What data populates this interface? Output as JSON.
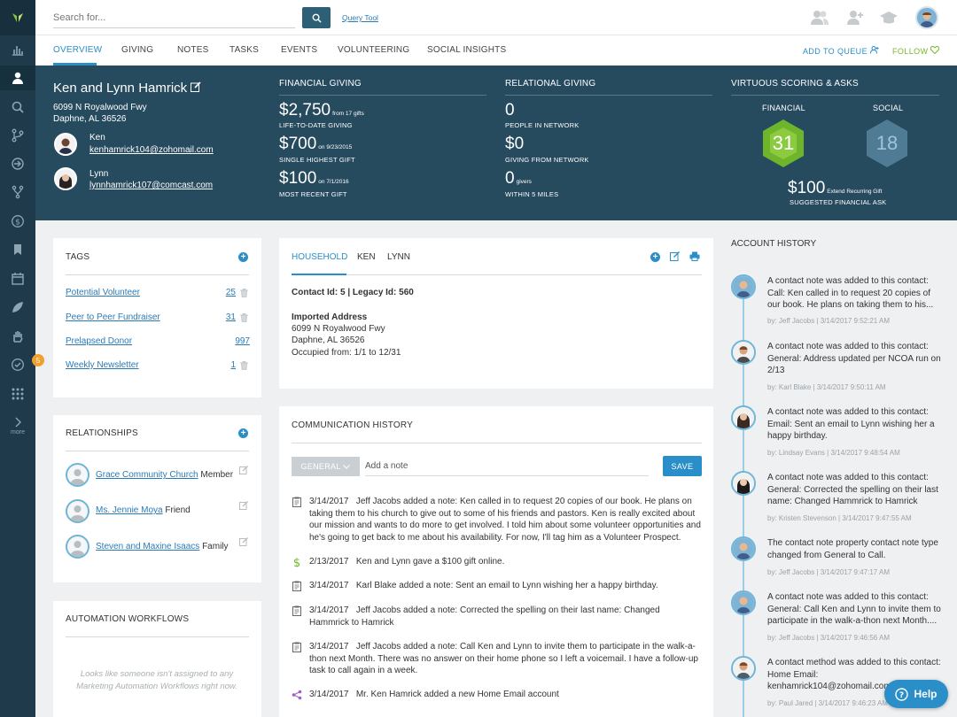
{
  "colors": {
    "rail": "#1f3a4b",
    "band": "#264a5e",
    "accent": "#2a8fc8",
    "follow": "#7ab72f",
    "financial_score": "#6fb52c",
    "social_score": "#4f7b95"
  },
  "rail": {
    "icons": [
      "logo-icon",
      "chart-icon",
      "person-icon",
      "search-icon",
      "branch-icon",
      "signin-icon",
      "fork-icon",
      "dollar-icon",
      "bookmark-icon",
      "calendar-icon",
      "leaf-icon",
      "hand-icon",
      "check-icon",
      "grid-icon",
      "chevron-right-icon"
    ],
    "badge": "5",
    "more": "more"
  },
  "topbar": {
    "search_placeholder": "Search for...",
    "query_tool": "Query Tool"
  },
  "nav": {
    "tabs": [
      "OVERVIEW",
      "GIVING",
      "NOTES",
      "TASKS",
      "EVENTS",
      "VOLUNTEERING",
      "SOCIAL INSIGHTS"
    ],
    "add_to_queue": "ADD TO QUEUE",
    "follow": "FOLLOW"
  },
  "profile": {
    "name": "Ken and Lynn Hamrick",
    "address1": "6099 N Royalwood Fwy",
    "address2": "Daphne, AL 36526",
    "people": [
      {
        "name": "Ken",
        "email": "kenhamrick104@zohomail.com"
      },
      {
        "name": "Lynn",
        "email": "lynnhamrick107@comcast.com"
      }
    ]
  },
  "financial": {
    "title": "FINANCIAL GIVING",
    "ltd_value": "$2,750",
    "ltd_note": "from 17 gifts",
    "ltd_label": "LIFE-TO-DATE GIVING",
    "high_value": "$700",
    "high_note": "on 9/23/2015",
    "high_label": "SINGLE HIGHEST GIFT",
    "recent_value": "$100",
    "recent_note": "on 7/1/2016",
    "recent_label": "MOST RECENT GIFT"
  },
  "relational": {
    "title": "RELATIONAL GIVING",
    "network_value": "0",
    "network_label": "PEOPLE IN NETWORK",
    "giving_value": "$0",
    "giving_label": "GIVING FROM NETWORK",
    "givers_value": "0",
    "givers_note": "givers",
    "givers_label": "WITHIN 5 MILES"
  },
  "scoring": {
    "title": "VIRTUOUS SCORING & ASKS",
    "financial_label": "FINANCIAL",
    "financial_score": "31",
    "social_label": "SOCIAL",
    "social_score": "18",
    "ask_value": "$100",
    "ask_note": "Extend Recurring Gift",
    "ask_label": "SUGGESTED FINANCIAL ASK"
  },
  "tags": {
    "title": "TAGS",
    "items": [
      {
        "label": "Potential Volunteer",
        "count": "25"
      },
      {
        "label": "Peer to Peer Fundraiser",
        "count": "31"
      },
      {
        "label": "Prelapsed Donor",
        "count": "997"
      },
      {
        "label": "Weekly Newsletter",
        "count": "1"
      }
    ]
  },
  "relationships": {
    "title": "RELATIONSHIPS",
    "items": [
      {
        "name": "Grace Community Church",
        "role": "Member"
      },
      {
        "name": "Ms. Jennie Moya",
        "role": "Friend"
      },
      {
        "name": "Steven and Maxine Isaacs",
        "role": "Family"
      }
    ]
  },
  "automation": {
    "title": "AUTOMATION WORKFLOWS",
    "empty": "Looks like someone isn't assigned to any Marketing Automation Workflows right now."
  },
  "household": {
    "tabs": [
      "HOUSEHOLD",
      "KEN",
      "LYNN"
    ],
    "contact_line": "Contact Id: 5 | Legacy Id: 560",
    "imported_label": "Imported Address",
    "addr1": "6099 N Royalwood Fwy",
    "addr2": "Daphne, AL 36526",
    "occupied": "Occupied from: 1/1 to 12/31"
  },
  "communication": {
    "title": "COMMUNICATION HISTORY",
    "dropdown": "GENERAL",
    "placeholder": "Add a note",
    "save": "SAVE",
    "items": [
      {
        "icon": "note-icon",
        "date": "3/14/2017",
        "text": "Jeff Jacobs added a note: Ken called in to request 20 copies of our book. He plans on taking them to his church to give out to some of his friends and pastors. Ken is really excited about our mission and wants to do more to get involved. I told him about some volunteer opportunities and he's going to get back to me about his availability. For now, I'll tag him as a Volunteer Prospect."
      },
      {
        "icon": "dollar-icon",
        "date": "2/13/2017",
        "text": "Ken and Lynn gave a $100 gift online."
      },
      {
        "icon": "note-icon",
        "date": "3/14/2017",
        "text": "Karl Blake added a note: Sent an email to Lynn wishing her a happy birthday."
      },
      {
        "icon": "note-icon",
        "date": "3/14/2017",
        "text": "Jeff Jacobs added a note: Corrected the spelling on their last name: Changed Hammrick to Hamrick"
      },
      {
        "icon": "note-icon",
        "date": "3/14/2017",
        "text": "Jeff Jacobs added a note: Call Ken and Lynn to invite them to participate in the walk-a-thon next Month. There was no answer on their home phone so I left a voicemail. I have a follow-up task to call again in a week."
      },
      {
        "icon": "share-icon",
        "date": "3/14/2017",
        "text": "Mr. Ken Hamrick added a new Home Email account"
      }
    ]
  },
  "account_history": {
    "title": "ACCOUNT HISTORY",
    "items": [
      {
        "text": "A contact note was added to this contact: Call: Ken called in to request 20 copies of our book.   He plans on taking them to his...",
        "meta": "by: Jeff Jacobs | 3/14/2017 9:52:21 AM"
      },
      {
        "text": "A contact note was added to this contact: General: Address updated per NCOA run on 2/13",
        "meta": "by: Karl Blake | 3/14/2017 9:50:11 AM"
      },
      {
        "text": "A contact note was added to this contact: Email: Sent an email to Lynn wishing her a happy birthday.",
        "meta": "by: Lindsay Evans | 3/14/2017 9:48:54 AM"
      },
      {
        "text": "A contact note was added to this contact: General: Corrected the spelling on their last name: Changed Hammrick to Hamrick",
        "meta": "by: Kristen Stevenson | 3/14/2017 9:47:55 AM"
      },
      {
        "text": "The contact note property contact note type changed from General to Call.",
        "meta": "by: Jeff Jacobs | 3/14/2017 9:47:17 AM"
      },
      {
        "text": "A contact note was added to this contact: General: Call Ken and Lynn to invite them to participate in the walk-a-thon next Month....",
        "meta": "by: Jeff Jacobs | 3/14/2017 9:46:56 AM"
      },
      {
        "text": "A contact method was added to this contact: Home Email: kenhamrick104@zohomail.com",
        "meta": "by: Paul Jared | 3/14/2017 9:46:23 AM"
      }
    ]
  },
  "help": "Help"
}
